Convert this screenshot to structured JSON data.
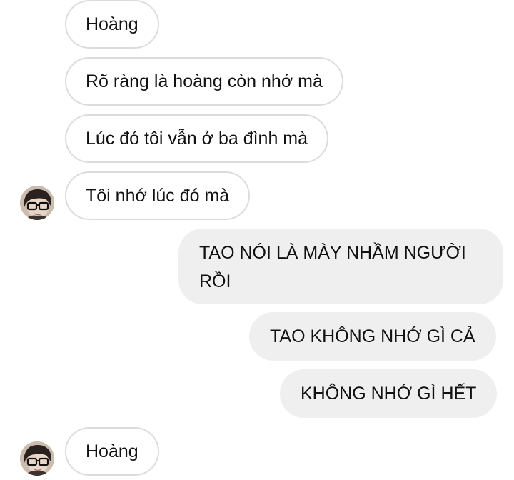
{
  "conversation": {
    "messages": [
      {
        "side": "incoming",
        "text": "Hoàng"
      },
      {
        "side": "incoming",
        "text": "Rõ ràng là hoàng còn nhớ mà"
      },
      {
        "side": "incoming",
        "text": "Lúc đó tôi vẫn ở ba đình mà"
      },
      {
        "side": "incoming",
        "text": "Tôi nhớ lúc đó mà",
        "avatar": true
      },
      {
        "side": "outgoing",
        "text": "TAO NÓI LÀ MÀY NHẦM NGƯỜI RỒI"
      },
      {
        "side": "outgoing",
        "text": "TAO KHÔNG NHỚ GÌ CẢ"
      },
      {
        "side": "outgoing",
        "text": "KHÔNG NHỚ GÌ HẾT"
      },
      {
        "side": "incoming",
        "text": "Hoàng",
        "avatar": true
      }
    ]
  },
  "colors": {
    "incoming_bubble": "#ffffff",
    "incoming_border": "#dcdcdc",
    "outgoing_bubble": "#efefef",
    "text": "#111111"
  },
  "icons": {
    "avatar": "contact-avatar-with-glasses"
  }
}
